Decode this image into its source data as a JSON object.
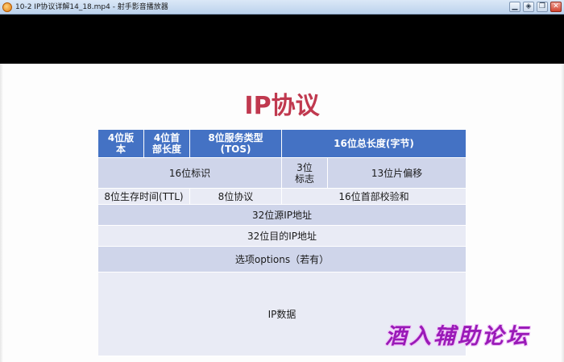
{
  "window": {
    "title": "10-2 IP协议详解14_18.mp4 - 射手影音播放器",
    "buttons": {
      "minimize": "▁",
      "mode": "◈",
      "restore": "❐",
      "close": "✕"
    }
  },
  "slide": {
    "title": "IP协议",
    "table": {
      "header": [
        "4位版本",
        "4位首部长度",
        "8位服务类型(TOS)",
        "16位总长度(字节)"
      ],
      "row2": {
        "identification": "16位标识",
        "flags": "3位标志",
        "fragment_offset": "13位片偏移"
      },
      "row3": {
        "ttl": "8位生存时间(TTL)",
        "protocol": "8位协议",
        "checksum": "16位首部校验和"
      },
      "row4": {
        "source_ip": "32位源IP地址"
      },
      "row5": {
        "dest_ip": "32位目的IP地址"
      },
      "row6": {
        "options": "选项options（若有）"
      },
      "row7": {
        "data": "IP数据"
      }
    }
  },
  "watermark": {
    "text": "酒入辅助论坛"
  },
  "colors": {
    "title": "#c0394f",
    "header": "#4472c4",
    "band_dark": "#cfd5ea",
    "band_light": "#e9ebf5",
    "watermark": "#9a1ab8"
  }
}
